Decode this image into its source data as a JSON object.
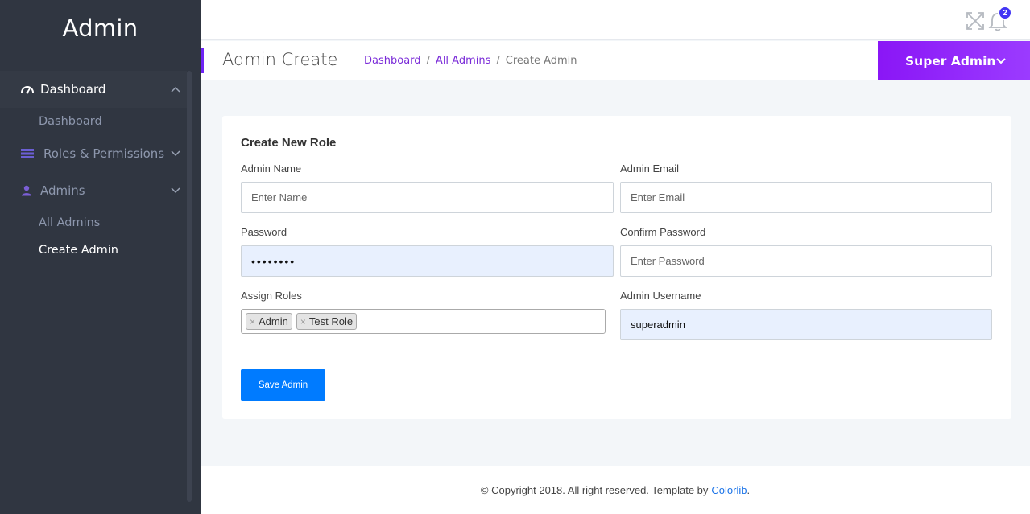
{
  "sidebar": {
    "brand": "Admin",
    "menu": [
      {
        "label": "Dashboard",
        "icon": "dashboard-gauge-icon",
        "expanded": true,
        "children": [
          "Dashboard"
        ]
      },
      {
        "label": "Roles & Permissions",
        "icon": "list-icon",
        "expanded": false
      },
      {
        "label": "Admins",
        "icon": "user-icon",
        "expanded": true,
        "children": [
          "All Admins",
          "Create Admin"
        ]
      }
    ]
  },
  "topbar": {
    "fullscreen_icon": "expand-icon",
    "notifications_icon": "bell-icon",
    "notification_count": "2"
  },
  "page": {
    "title": "Admin Create",
    "breadcrumb": [
      "Dashboard",
      "All Admins",
      "Create Admin"
    ],
    "separator": "/",
    "user_menu": "Super Admin"
  },
  "form": {
    "title": "Create New Role",
    "fields": {
      "name": {
        "label": "Admin Name",
        "placeholder": "Enter Name",
        "value": ""
      },
      "email": {
        "label": "Admin Email",
        "placeholder": "Enter Email",
        "value": ""
      },
      "password": {
        "label": "Password",
        "value": "••••••••"
      },
      "confirm_password": {
        "label": "Confirm Password",
        "placeholder": "Enter Password",
        "value": ""
      },
      "roles": {
        "label": "Assign Roles",
        "selected": [
          "Admin",
          "Test Role"
        ],
        "remove_glyph": "×"
      },
      "username": {
        "label": "Admin Username",
        "value": "superadmin"
      }
    },
    "submit_label": "Save Admin"
  },
  "footer": {
    "text": "© Copyright 2018. All right reserved. Template by",
    "link": "Colorlib",
    "end": "."
  },
  "colors": {
    "sidebar_bg": "#303641",
    "accent_purple": "#8a16f6",
    "primary_button": "#007bff",
    "badge": "#4336f4",
    "autofill_bg": "#e8f0fe"
  }
}
